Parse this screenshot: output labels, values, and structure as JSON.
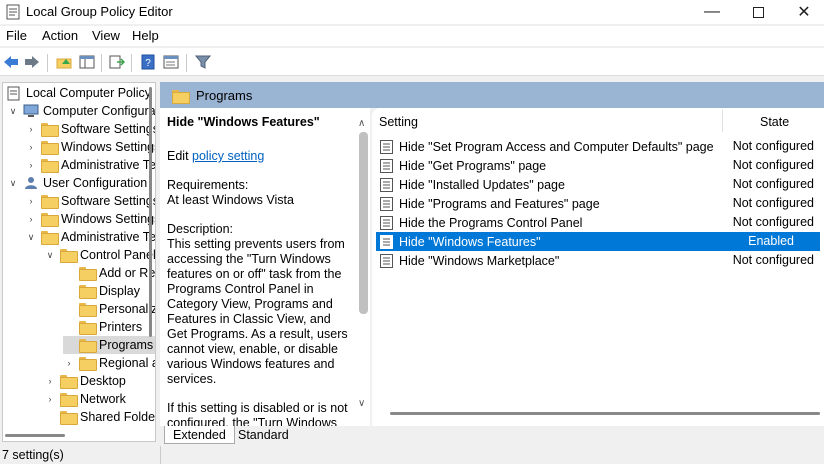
{
  "window": {
    "title": "Local Group Policy Editor"
  },
  "menu": [
    "File",
    "Action",
    "View",
    "Help"
  ],
  "toolbar_icons": [
    "back-arrow-icon",
    "forward-arrow-icon",
    "up-folder-icon",
    "show-hide-tree-icon",
    "export-list-icon",
    "help-icon",
    "properties-icon",
    "filter-icon"
  ],
  "tree": {
    "root": "Local Computer Policy",
    "items": [
      {
        "label": "Computer Configuration",
        "level": 1,
        "arrow": "down"
      },
      {
        "label": "Software Settings",
        "level": 2,
        "arrow": "right"
      },
      {
        "label": "Windows Settings",
        "level": 2,
        "arrow": "right"
      },
      {
        "label": "Administrative Templates",
        "level": 2,
        "arrow": "right"
      },
      {
        "label": "User Configuration",
        "level": 1,
        "arrow": "down"
      },
      {
        "label": "Software Settings",
        "level": 2,
        "arrow": "right"
      },
      {
        "label": "Windows Settings",
        "level": 2,
        "arrow": "right"
      },
      {
        "label": "Administrative Templates",
        "level": 2,
        "arrow": "down"
      },
      {
        "label": "Control Panel",
        "level": 3,
        "arrow": "down"
      },
      {
        "label": "Add or Remove Programs",
        "level": 4,
        "arrow": ""
      },
      {
        "label": "Display",
        "level": 4,
        "arrow": ""
      },
      {
        "label": "Personalization",
        "level": 4,
        "arrow": ""
      },
      {
        "label": "Printers",
        "level": 4,
        "arrow": ""
      },
      {
        "label": "Programs",
        "level": 4,
        "arrow": "",
        "selected": true
      },
      {
        "label": "Regional and Language Options",
        "level": 4,
        "arrow": "right"
      },
      {
        "label": "Desktop",
        "level": 3,
        "arrow": "right"
      },
      {
        "label": "Network",
        "level": 3,
        "arrow": "right"
      },
      {
        "label": "Shared Folders",
        "level": 3,
        "arrow": ""
      }
    ]
  },
  "header": {
    "title": "Programs"
  },
  "description": {
    "title": "Hide \"Windows Features\"",
    "edit_prefix": "Edit",
    "edit_link": "policy setting",
    "req_label": "Requirements:",
    "req_value": "At least Windows Vista",
    "desc_label": "Description:",
    "desc_text": "This setting prevents users from accessing the \"Turn Windows features on or off\" task from the Programs Control Panel in Category View, Programs and Features in Classic View, and Get Programs.  As a result, users cannot view, enable, or disable various Windows features and services.",
    "more_text": "If this setting is disabled or is not configured, the \"Turn Windows"
  },
  "list": {
    "col_setting": "Setting",
    "col_state": "State",
    "rows": [
      {
        "name": "Hide \"Set Program Access and Computer Defaults\" page",
        "state": "Not configured"
      },
      {
        "name": "Hide \"Get Programs\" page",
        "state": "Not configured"
      },
      {
        "name": "Hide \"Installed Updates\" page",
        "state": "Not configured"
      },
      {
        "name": "Hide \"Programs and Features\" page",
        "state": "Not configured"
      },
      {
        "name": "Hide the Programs Control Panel",
        "state": "Not configured"
      },
      {
        "name": "Hide \"Windows Features\"",
        "state": "Enabled",
        "selected": true
      },
      {
        "name": "Hide \"Windows Marketplace\"",
        "state": "Not configured"
      }
    ]
  },
  "tabs": {
    "extended": "Extended",
    "standard": "Standard"
  },
  "status": {
    "text": "7 setting(s)"
  },
  "colors": {
    "accent": "#0078d7",
    "header_band": "#9ab4d3",
    "link": "#0060c0"
  }
}
